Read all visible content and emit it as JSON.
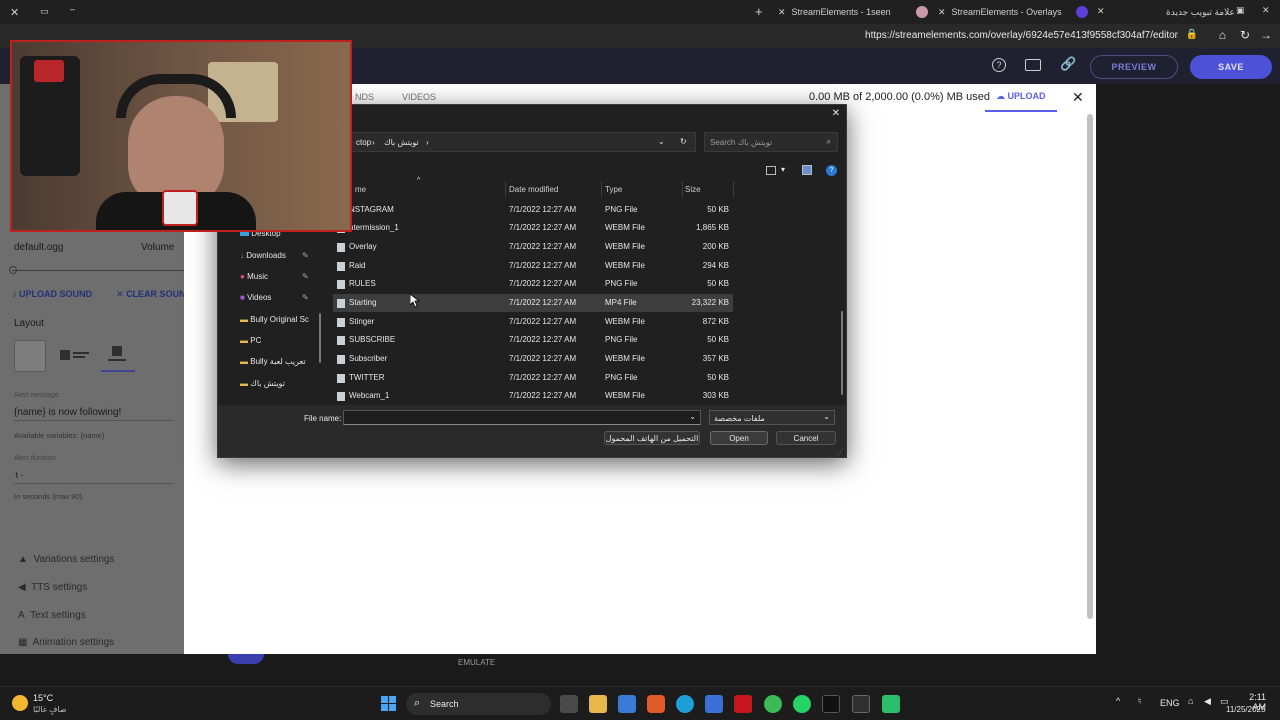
{
  "browser": {
    "tabs": [
      {
        "label": "StreamElements - 1seen"
      },
      {
        "label": "StreamElements - Overlays"
      },
      {
        "label": "علامة تبويب جديدة"
      }
    ],
    "url": "https://streamelements.com/overlay/6924e57e413f9558cf304af7/editor"
  },
  "header": {
    "preview_label": "PREVIEW",
    "save_label": "SAVE"
  },
  "uploader": {
    "tab_sounds": "NDS",
    "tab_videos": "VIDEOS",
    "storage_text": "0.00 MB of 2,000.00 (0.0%) MB used",
    "upload_label": "UPLOAD"
  },
  "left_panel": {
    "sound_file": "default.ogg",
    "volume_label": "Volume",
    "upload_sound": "UPLOAD SOUND",
    "clear_sound": "CLEAR SOUND",
    "layout_label": "Layout",
    "alert_message_label": "Alert message",
    "alert_message_value": "{name} is now following!",
    "available_vars": "Available variables: {name}",
    "alert_duration_label": "Alert duration",
    "alert_duration_value": "١٠",
    "duration_hint": "In seconds (max 90).",
    "sections": [
      "Variations settings",
      "TTS settings",
      "Text settings",
      "Animation settings"
    ]
  },
  "bottom_toolbar": {
    "emulate_label": "EMULATE"
  },
  "dialog": {
    "breadcrumb_1": "ctop",
    "breadcrumb_2": "تويتش باك",
    "search_placeholder": "Search تويتش باك",
    "columns": {
      "name": "me",
      "date": "Date modified",
      "type": "Type",
      "size": "Size"
    },
    "sidebar": [
      {
        "label": "Desktop",
        "icon": "desktop-icon",
        "pinned": false
      },
      {
        "label": "Downloads",
        "icon": "download-icon",
        "pinned": true
      },
      {
        "label": "Music",
        "icon": "music-icon",
        "pinned": true
      },
      {
        "label": "Videos",
        "icon": "video-icon",
        "pinned": true
      },
      {
        "label": "Bully Original Sc",
        "icon": "folder-icon",
        "pinned": false
      },
      {
        "label": "PC",
        "icon": "folder-icon",
        "pinned": false
      },
      {
        "label": "Bully تعريب لعبة",
        "icon": "folder-icon",
        "pinned": false
      },
      {
        "label": "تويتش باك",
        "icon": "folder-icon",
        "pinned": false
      }
    ],
    "files": [
      {
        "name": "NSTAGRAM",
        "date": "7/1/2022 12:27 AM",
        "type": "PNG File",
        "size": "50 KB"
      },
      {
        "name": "ntermission_1",
        "date": "7/1/2022 12:27 AM",
        "type": "WEBM File",
        "size": "1,865 KB"
      },
      {
        "name": "Overlay",
        "date": "7/1/2022 12:27 AM",
        "type": "WEBM File",
        "size": "200 KB"
      },
      {
        "name": "Raid",
        "date": "7/1/2022 12:27 AM",
        "type": "WEBM File",
        "size": "294 KB"
      },
      {
        "name": "RULES",
        "date": "7/1/2022 12:27 AM",
        "type": "PNG File",
        "size": "50 KB"
      },
      {
        "name": "Starting",
        "date": "7/1/2022 12:27 AM",
        "type": "MP4 File",
        "size": "23,322 KB"
      },
      {
        "name": "Stinger",
        "date": "7/1/2022 12:27 AM",
        "type": "WEBM File",
        "size": "872 KB"
      },
      {
        "name": "SUBSCRIBE",
        "date": "7/1/2022 12:27 AM",
        "type": "PNG File",
        "size": "50 KB"
      },
      {
        "name": "Subscriber",
        "date": "7/1/2022 12:27 AM",
        "type": "WEBM File",
        "size": "357 KB"
      },
      {
        "name": "TWITTER",
        "date": "7/1/2022 12:27 AM",
        "type": "PNG File",
        "size": "50 KB"
      },
      {
        "name": "Webcam_1",
        "date": "7/1/2022 12:27 AM",
        "type": "WEBM File",
        "size": "303 KB"
      }
    ],
    "file_name_label": "File name:",
    "file_name_value": "",
    "filter_value": "ملفات مخصصة",
    "mobile_button": "التحميل من الهاتف المحمول",
    "open_button": "Open",
    "cancel_button": "Cancel"
  },
  "taskbar": {
    "weather_temp": "15°C",
    "weather_desc": "صافٍ غالبًا",
    "search_label": "Search",
    "lang": "ENG",
    "time": "2:11 AM",
    "date": "11/25/2025"
  },
  "colors": {
    "accent": "#5a5ff0",
    "save": "#4d51d8",
    "highlight": "#3d3d3d",
    "webcam_border": "#c0201e"
  }
}
